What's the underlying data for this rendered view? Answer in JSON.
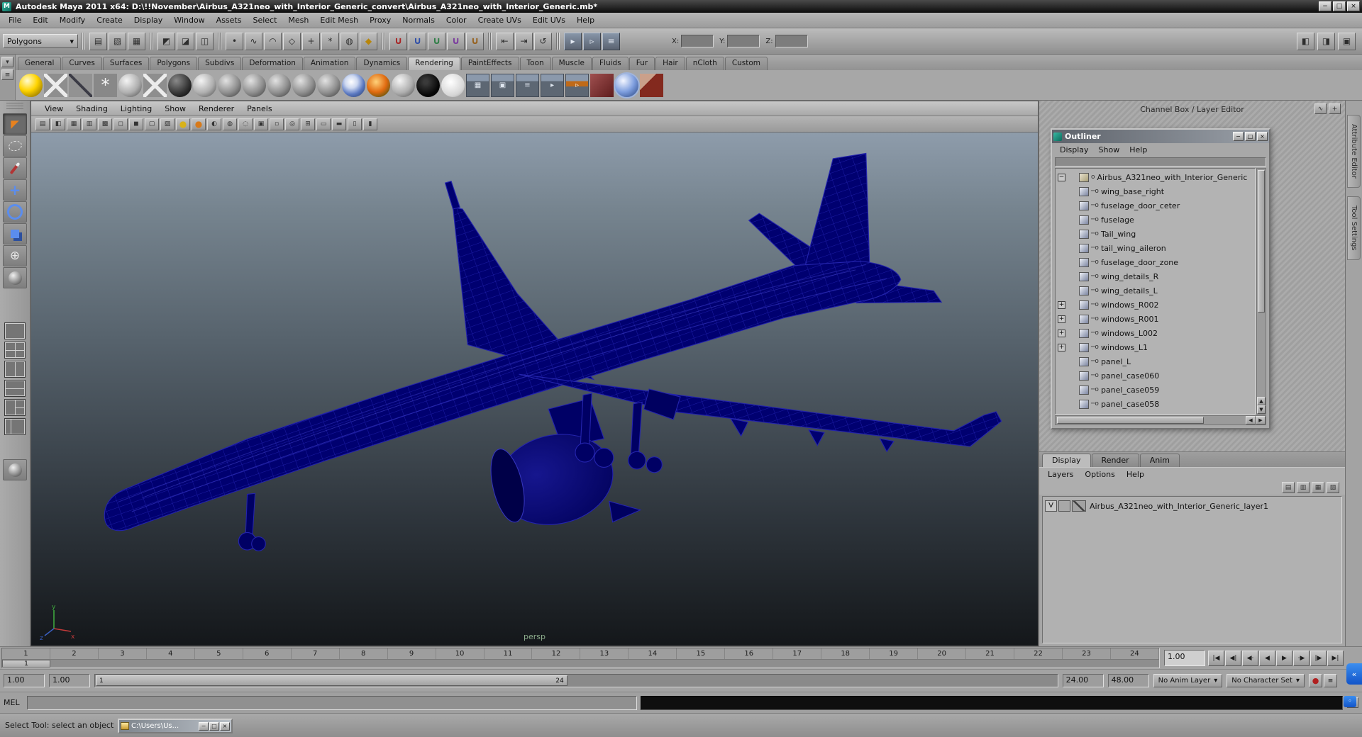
{
  "titlebar": {
    "title": "Autodesk Maya 2011 x64: D:\\!!November\\Airbus_A321neo_with_Interior_Generic_convert\\Airbus_A321neo_with_Interior_Generic.mb*",
    "app_initial": "M",
    "buttons": [
      {
        "n": "minimize-button",
        "g": "−"
      },
      {
        "n": "maximize-button",
        "g": "□"
      },
      {
        "n": "close-button",
        "g": "×"
      }
    ]
  },
  "menubar": [
    "File",
    "Edit",
    "Modify",
    "Create",
    "Display",
    "Window",
    "Assets",
    "Select",
    "Mesh",
    "Edit Mesh",
    "Proxy",
    "Normals",
    "Color",
    "Create UVs",
    "Edit UVs",
    "Help"
  ],
  "statusline": {
    "menuset": "Polygons",
    "groups": [
      [
        {
          "n": "new-scene-icon",
          "g": "▤"
        },
        {
          "n": "open-scene-icon",
          "g": "▧"
        },
        {
          "n": "save-scene-icon",
          "g": "▦"
        }
      ],
      [
        {
          "n": "select-hierarchy-icon",
          "g": "◩"
        },
        {
          "n": "select-object-icon",
          "g": "◪"
        },
        {
          "n": "select-component-icon",
          "g": "◫"
        }
      ],
      [
        {
          "n": "select-handles-icon",
          "g": "•"
        },
        {
          "n": "select-curves-icon",
          "g": "∿"
        },
        {
          "n": "select-surfaces-icon",
          "g": "◠"
        },
        {
          "n": "select-deformations-icon",
          "g": "◇"
        },
        {
          "n": "select-joints-icon",
          "g": "+"
        },
        {
          "n": "select-dynamics-icon",
          "g": "*"
        },
        {
          "n": "select-rendering-icon",
          "g": "◍"
        },
        {
          "n": "lock-selection-icon",
          "g": "◆",
          "s": "gold"
        }
      ],
      [
        {
          "n": "snap-to-grid-icon",
          "g": "∪",
          "s": "mag-red"
        },
        {
          "n": "snap-to-curve-icon",
          "g": "∪",
          "s": "mag-blue"
        },
        {
          "n": "snap-to-point-icon",
          "g": "∪",
          "s": "mag-green"
        },
        {
          "n": "snap-to-plane-icon",
          "g": "∪",
          "s": "mag-purple"
        },
        {
          "n": "make-live-icon",
          "g": "∪",
          "s": "mag-brown"
        }
      ],
      [
        {
          "n": "input-connections-icon",
          "g": "⇤"
        },
        {
          "n": "output-connections-icon",
          "g": "⇥"
        },
        {
          "n": "construction-history-icon",
          "g": "↺"
        }
      ],
      [
        {
          "n": "render-current-frame-icon",
          "g": "▸",
          "s": "steel"
        },
        {
          "n": "ipr-render-icon",
          "g": "▹",
          "s": "steel"
        },
        {
          "n": "render-settings-icon",
          "g": "≡",
          "s": "steel"
        }
      ]
    ],
    "coords": [
      {
        "label": "X:",
        "value": ""
      },
      {
        "label": "Y:",
        "value": ""
      },
      {
        "label": "Z:",
        "value": ""
      }
    ],
    "right_toggles": [
      {
        "n": "toggle-left-panels-icon",
        "g": "◧"
      },
      {
        "n": "toggle-right-panels-icon",
        "g": "◨"
      },
      {
        "n": "toggle-all-panels-icon",
        "g": "▣"
      }
    ]
  },
  "shelf": {
    "side_buttons": [
      {
        "n": "shelf-tab-menu-button",
        "g": "▾"
      },
      {
        "n": "shelf-menu-button",
        "g": "≡"
      }
    ],
    "tabs": [
      "General",
      "Curves",
      "Surfaces",
      "Polygons",
      "Subdivs",
      "Deformation",
      "Animation",
      "Dynamics",
      "Rendering",
      "PaintEffects",
      "Toon",
      "Muscle",
      "Fluids",
      "Fur",
      "Hair",
      "nCloth",
      "Custom"
    ],
    "active_tab": "Rendering",
    "icons": [
      {
        "n": "point-light-icon",
        "s": "ball-yellow"
      },
      {
        "n": "spot-light-icon",
        "s": "rays"
      },
      {
        "n": "directional-light-icon",
        "s": "needle"
      },
      {
        "n": "area-light-icon",
        "g": "*",
        "s": "star"
      },
      {
        "n": "ambient-light-icon",
        "s": "ball-silver"
      },
      {
        "n": "volume-light-icon",
        "s": "rays"
      },
      {
        "n": "env-sphere-icon",
        "s": "ball-dark"
      },
      {
        "n": "shaded-sphere-icon",
        "s": "ball-silver"
      },
      {
        "n": "lambert-material-icon",
        "s": "ball-gray"
      },
      {
        "n": "blinn-material-icon",
        "s": "ball-gray"
      },
      {
        "n": "phong-material-icon",
        "s": "ball-gray"
      },
      {
        "n": "phonge-material-icon",
        "s": "ball-gray"
      },
      {
        "n": "anisotropic-material-icon",
        "s": "ball-gray"
      },
      {
        "n": "ramp-shader-icon",
        "s": "ball-marble"
      },
      {
        "n": "ocean-shader-icon",
        "s": "ball-ocean"
      },
      {
        "n": "surface-shader-icon",
        "s": "ball-silver"
      },
      {
        "n": "black-sphere-icon",
        "s": "circle-black"
      },
      {
        "n": "white-sphere-icon",
        "s": "circle-white"
      },
      {
        "n": "hypershade-icon",
        "g": "▦",
        "s": "slate"
      },
      {
        "n": "render-view-icon",
        "g": "▣",
        "s": "slate"
      },
      {
        "n": "render-globals-icon",
        "g": "≡",
        "s": "slate"
      },
      {
        "n": "ipr-render-shelf-icon",
        "g": "▸",
        "s": "slate"
      },
      {
        "n": "batch-render-icon",
        "g": "▹",
        "s": "slate-orange"
      },
      {
        "n": "paint-effects-icon",
        "s": "red-tool"
      },
      {
        "n": "render-layers-icon",
        "s": "ball-ring"
      },
      {
        "n": "3d-paint-icon",
        "s": "brush"
      }
    ]
  },
  "toolbox": {
    "tools": [
      {
        "n": "select-tool",
        "g": "◤",
        "s": "select active"
      },
      {
        "n": "lasso-tool",
        "s": "lasso"
      },
      {
        "n": "paint-select-tool",
        "s": "paintsel"
      },
      {
        "n": "move-tool",
        "g": "+",
        "s": "move"
      },
      {
        "n": "rotate-tool",
        "s": "rotate"
      },
      {
        "n": "scale-tool",
        "s": "scale"
      },
      {
        "n": "universal-manipulator-tool",
        "g": "⊕",
        "s": "universal"
      },
      {
        "n": "soft-modification-tool",
        "s": "softmod"
      }
    ],
    "layouts": [
      {
        "n": "single-pane-layout-button",
        "s": "l1"
      },
      {
        "n": "four-pane-layout-button",
        "s": "l4"
      },
      {
        "n": "two-pane-vertical-layout-button",
        "s": "l2v"
      },
      {
        "n": "two-pane-horizontal-layout-button",
        "s": "l2h"
      },
      {
        "n": "three-pane-layout-button",
        "s": "l3"
      },
      {
        "n": "outliner-persp-layout-button",
        "s": "lol"
      }
    ],
    "bottom": [
      {
        "n": "custom-layout-button",
        "s": "softmod"
      }
    ]
  },
  "viewport": {
    "menus": [
      "View",
      "Shading",
      "Lighting",
      "Show",
      "Renderer",
      "Panels"
    ],
    "toolbar_icons": [
      {
        "n": "select-camera-icon",
        "g": "▤"
      },
      {
        "n": "lock-camera-icon",
        "g": "◧"
      },
      {
        "n": "camera-attributes-icon",
        "g": "▦"
      },
      {
        "n": "bookmarks-icon",
        "g": "▥"
      },
      {
        "n": "image-plane-icon",
        "g": "▩"
      },
      {
        "n": "wireframe-mode-icon",
        "g": "◻"
      },
      {
        "n": "smooth-shade-icon",
        "g": "◼"
      },
      {
        "n": "bounding-box-icon",
        "g": "▢"
      },
      {
        "n": "textured-mode-icon",
        "g": "▨"
      },
      {
        "n": "use-default-lighting-icon",
        "g": "●",
        "s": "dotyellow"
      },
      {
        "n": "use-all-lights-icon",
        "g": "●",
        "s": "dotorange"
      },
      {
        "n": "shadows-icon",
        "g": "◐"
      },
      {
        "n": "screen-space-ao-icon",
        "g": "◍"
      },
      {
        "n": "motion-blur-icon",
        "g": "◌"
      },
      {
        "n": "multisample-icon",
        "g": "▣"
      },
      {
        "n": "xray-icon",
        "g": "▫"
      },
      {
        "n": "isolate-select-icon",
        "g": "◎"
      },
      {
        "n": "field-chart-icon",
        "g": "⊞"
      },
      {
        "n": "resolution-gate-icon",
        "g": "▭"
      },
      {
        "n": "gate-mask-icon",
        "g": "▬"
      },
      {
        "n": "safe-action-icon",
        "g": "▯"
      },
      {
        "n": "safe-title-icon",
        "g": "▮"
      }
    ],
    "camera": "persp",
    "axis": {
      "x": "x",
      "y": "y",
      "z": "z"
    }
  },
  "dock": {
    "header": "Channel Box / Layer Editor",
    "header_icons": [
      {
        "n": "channel-slider-speed-icon",
        "g": "∿"
      },
      {
        "n": "channel-manipulator-icon",
        "g": "+"
      }
    ]
  },
  "outliner": {
    "title": "Outliner",
    "window_buttons": [
      {
        "n": "outliner-minimize-button",
        "g": "−"
      },
      {
        "n": "outliner-maximize-button",
        "g": "□"
      },
      {
        "n": "outliner-close-button",
        "g": "×"
      }
    ],
    "menus": [
      "Display",
      "Show",
      "Help"
    ],
    "root": {
      "label": "Airbus_A321neo_with_Interior_Generic"
    },
    "children": [
      {
        "label": "wing_base_right"
      },
      {
        "label": "fuselage_door_ceter"
      },
      {
        "label": "fuselage"
      },
      {
        "label": "Tail_wing"
      },
      {
        "label": "tail_wing_aileron"
      },
      {
        "label": "fuselage_door_zone"
      },
      {
        "label": "wing_details_R"
      },
      {
        "label": "wing_details_L"
      },
      {
        "label": "windows_R002",
        "expandable": true
      },
      {
        "label": "windows_R001",
        "expandable": true
      },
      {
        "label": "windows_L002",
        "expandable": true
      },
      {
        "label": "windows_L1",
        "expandable": true
      },
      {
        "label": "panel_L"
      },
      {
        "label": "panel_case060"
      },
      {
        "label": "panel_case059"
      },
      {
        "label": "panel_case058"
      }
    ]
  },
  "layer_editor": {
    "tabs": [
      "Display",
      "Render",
      "Anim"
    ],
    "active_tab": "Display",
    "menus": [
      "Layers",
      "Options",
      "Help"
    ],
    "icon_buttons": [
      {
        "n": "layer-sort-icon",
        "g": "▤"
      },
      {
        "n": "layer-move-icon",
        "g": "▥"
      },
      {
        "n": "create-empty-layer-icon",
        "g": "▦"
      },
      {
        "n": "create-layer-from-selected-icon",
        "g": "▧"
      }
    ],
    "layers": [
      {
        "visibility": "V",
        "name": "Airbus_A321neo_with_Interior_Generic_layer1"
      }
    ]
  },
  "edge_tabs": [
    "Attribute Editor",
    "Tool Settings"
  ],
  "timeline": {
    "ticks": [
      "1",
      "2",
      "3",
      "4",
      "5",
      "6",
      "7",
      "8",
      "9",
      "10",
      "11",
      "12",
      "13",
      "14",
      "15",
      "16",
      "17",
      "18",
      "19",
      "20",
      "21",
      "22",
      "23",
      "24"
    ],
    "current_frame": "1",
    "time_field": "1.00",
    "playback": [
      {
        "n": "go-to-start-button",
        "g": "|◀"
      },
      {
        "n": "step-back-frame-button",
        "g": "◀|"
      },
      {
        "n": "step-back-key-button",
        "g": "◀·"
      },
      {
        "n": "play-backwards-button",
        "g": "◀"
      },
      {
        "n": "play-forwards-button",
        "g": "▶"
      },
      {
        "n": "step-forward-key-button",
        "g": "·▶"
      },
      {
        "n": "step-forward-frame-button",
        "g": "|▶"
      },
      {
        "n": "go-to-end-button",
        "g": "▶|"
      }
    ]
  },
  "range_slider": {
    "anim_start": "1.00",
    "playback_start": "1.00",
    "range_start": "1",
    "range_end": "24",
    "playback_end": "24.00",
    "anim_end": "48.00",
    "anim_layer": "No Anim Layer",
    "character_set": "No Character Set",
    "buttons": [
      {
        "n": "auto-keyframe-button",
        "g": "●",
        "s": "autokey"
      },
      {
        "n": "animation-preferences-button",
        "g": "≡"
      }
    ]
  },
  "command_line": {
    "label": "MEL",
    "buttons": [
      {
        "n": "script-editor-button",
        "g": "≡"
      }
    ]
  },
  "help_line": {
    "status": "Select Tool: select an object",
    "mini_window_title": "C:\\Users\\Us...",
    "mini_buttons": [
      {
        "n": "mini-minimize-button",
        "g": "−"
      },
      {
        "n": "mini-restore-button",
        "g": "□"
      },
      {
        "n": "mini-close-button",
        "g": "×"
      }
    ]
  },
  "overlay_icons": {
    "teamviewer_arrows": "«",
    "teamviewer_dot": "◦"
  },
  "colors": {
    "wireframe_navy": "#000070",
    "wire_line_blue": "#2626b0",
    "autokey_red": "#b02020",
    "teamviewer_blue": "#1f6fe0",
    "viewport_top": "#8e9cab",
    "viewport_bottom": "#14171a"
  }
}
